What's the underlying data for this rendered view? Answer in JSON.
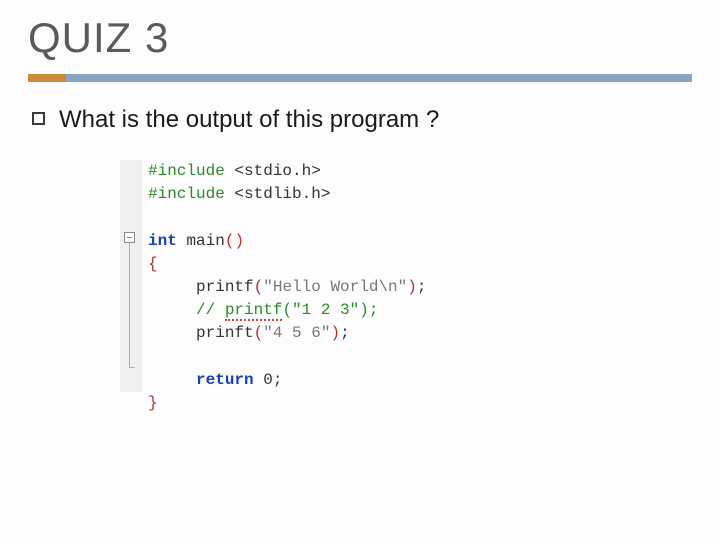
{
  "slide": {
    "title": "QUIZ 3",
    "question": "What is the output of this program ?"
  },
  "code": {
    "include1_pp": "#include ",
    "include1_hdr": "<stdio.h>",
    "include2_pp": "#include ",
    "include2_hdr": "<stdlib.h>",
    "int_kw": "int",
    "main_name": " main",
    "open_paren": "(",
    "close_paren": ")",
    "brace_open": "{",
    "printf1_name": "printf",
    "printf1_arg": "\"Hello World\\n\"",
    "semicolon": ";",
    "comment_pre": "// ",
    "comment_fn": "printf",
    "comment_args": "(\"1 2 3\");",
    "printf2_name": "prinft",
    "printf2_arg": "\"4 5 6\"",
    "return_kw": "return",
    "return_val": " 0",
    "brace_close": "}",
    "indent": "     "
  }
}
